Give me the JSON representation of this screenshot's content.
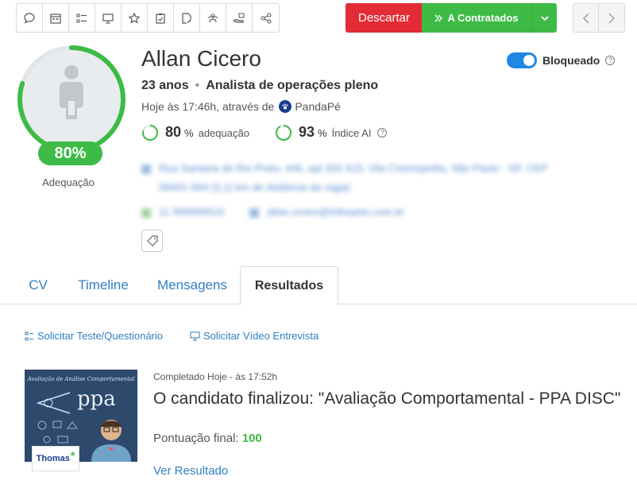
{
  "toolbar": {
    "icons": [
      "chat-icon",
      "calendar-icon",
      "list-icon",
      "monitor-icon",
      "star-icon",
      "clipboard-check-icon",
      "document-edit-icon",
      "users-icon",
      "hand-money-icon",
      "share-icon"
    ]
  },
  "actions": {
    "discard_label": "Descartar",
    "hire_label": "A Contratados",
    "accent_green": "#3dbb46",
    "accent_red": "#e32b35"
  },
  "candidate": {
    "name": "Allan Cicero",
    "age": "23 anos",
    "position": "Analista de operações pleno",
    "applied_prefix": "Hoje às 17:46h, através de",
    "source": "PandaPé",
    "score_pill": "80%",
    "score_label": "Adequação",
    "score_value": 80,
    "address_line1": "Rua Santana do Rio Preto, 446, apt 302 615, Vila Cosmopolita, São Paulo - SP, CEP",
    "address_line2": "08401-564 (3,1) km de distância da vaga)",
    "phone": "11 999999523",
    "email": "allan.cicero@inforpeto.com.br"
  },
  "metrics": {
    "adequacao_value": "80",
    "adequacao_pct": "%",
    "adequacao_label": "adequação",
    "ai_value": "93",
    "ai_pct": "%",
    "ai_label": "Índice AI"
  },
  "blocked": {
    "label": "Bloqueado",
    "enabled": true
  },
  "tabs": [
    {
      "label": "CV"
    },
    {
      "label": "Timeline"
    },
    {
      "label": "Mensagens"
    },
    {
      "label": "Resultados",
      "active": true
    }
  ],
  "results": {
    "request_test_label": "Solicitar Teste/Questionário",
    "request_video_label": "Solicitar Vídeo Entrevista",
    "thumb_title": "Avaliação de Análise Comportamental",
    "thumb_brand": "ppa",
    "thumb_logo": "Thomas",
    "completed": "Completado Hoje - às 17:52h",
    "title": "O candidato finalizou: \"Avaliação Comportamental - PPA DISC\"",
    "final_score_label": "Pontuação final:",
    "final_score_value": "100",
    "view_label": "Ver Resultado"
  }
}
